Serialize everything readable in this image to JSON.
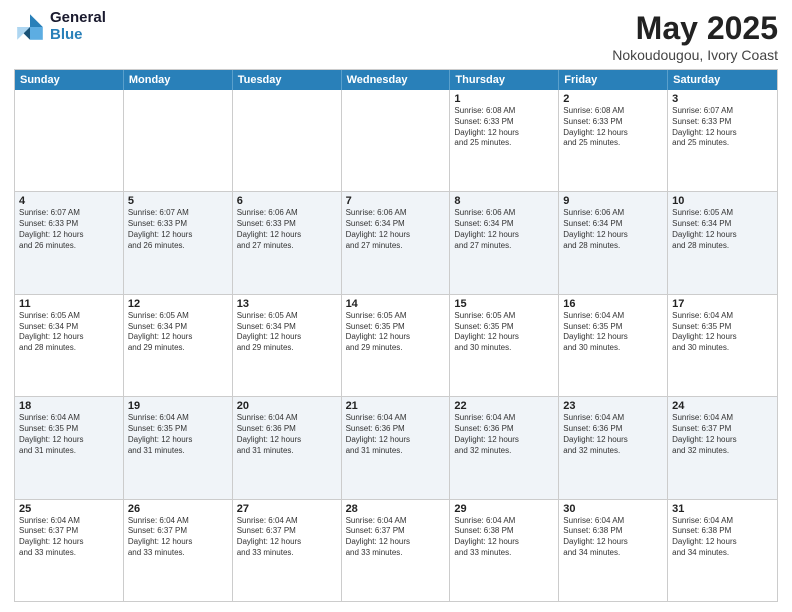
{
  "logo": {
    "line1": "General",
    "line2": "Blue"
  },
  "title": "May 2025",
  "subtitle": "Nokoudougou, Ivory Coast",
  "header_days": [
    "Sunday",
    "Monday",
    "Tuesday",
    "Wednesday",
    "Thursday",
    "Friday",
    "Saturday"
  ],
  "rows": [
    [
      {
        "day": "",
        "info": ""
      },
      {
        "day": "",
        "info": ""
      },
      {
        "day": "",
        "info": ""
      },
      {
        "day": "",
        "info": ""
      },
      {
        "day": "1",
        "info": "Sunrise: 6:08 AM\nSunset: 6:33 PM\nDaylight: 12 hours\nand 25 minutes."
      },
      {
        "day": "2",
        "info": "Sunrise: 6:08 AM\nSunset: 6:33 PM\nDaylight: 12 hours\nand 25 minutes."
      },
      {
        "day": "3",
        "info": "Sunrise: 6:07 AM\nSunset: 6:33 PM\nDaylight: 12 hours\nand 25 minutes."
      }
    ],
    [
      {
        "day": "4",
        "info": "Sunrise: 6:07 AM\nSunset: 6:33 PM\nDaylight: 12 hours\nand 26 minutes."
      },
      {
        "day": "5",
        "info": "Sunrise: 6:07 AM\nSunset: 6:33 PM\nDaylight: 12 hours\nand 26 minutes."
      },
      {
        "day": "6",
        "info": "Sunrise: 6:06 AM\nSunset: 6:33 PM\nDaylight: 12 hours\nand 27 minutes."
      },
      {
        "day": "7",
        "info": "Sunrise: 6:06 AM\nSunset: 6:34 PM\nDaylight: 12 hours\nand 27 minutes."
      },
      {
        "day": "8",
        "info": "Sunrise: 6:06 AM\nSunset: 6:34 PM\nDaylight: 12 hours\nand 27 minutes."
      },
      {
        "day": "9",
        "info": "Sunrise: 6:06 AM\nSunset: 6:34 PM\nDaylight: 12 hours\nand 28 minutes."
      },
      {
        "day": "10",
        "info": "Sunrise: 6:05 AM\nSunset: 6:34 PM\nDaylight: 12 hours\nand 28 minutes."
      }
    ],
    [
      {
        "day": "11",
        "info": "Sunrise: 6:05 AM\nSunset: 6:34 PM\nDaylight: 12 hours\nand 28 minutes."
      },
      {
        "day": "12",
        "info": "Sunrise: 6:05 AM\nSunset: 6:34 PM\nDaylight: 12 hours\nand 29 minutes."
      },
      {
        "day": "13",
        "info": "Sunrise: 6:05 AM\nSunset: 6:34 PM\nDaylight: 12 hours\nand 29 minutes."
      },
      {
        "day": "14",
        "info": "Sunrise: 6:05 AM\nSunset: 6:35 PM\nDaylight: 12 hours\nand 29 minutes."
      },
      {
        "day": "15",
        "info": "Sunrise: 6:05 AM\nSunset: 6:35 PM\nDaylight: 12 hours\nand 30 minutes."
      },
      {
        "day": "16",
        "info": "Sunrise: 6:04 AM\nSunset: 6:35 PM\nDaylight: 12 hours\nand 30 minutes."
      },
      {
        "day": "17",
        "info": "Sunrise: 6:04 AM\nSunset: 6:35 PM\nDaylight: 12 hours\nand 30 minutes."
      }
    ],
    [
      {
        "day": "18",
        "info": "Sunrise: 6:04 AM\nSunset: 6:35 PM\nDaylight: 12 hours\nand 31 minutes."
      },
      {
        "day": "19",
        "info": "Sunrise: 6:04 AM\nSunset: 6:35 PM\nDaylight: 12 hours\nand 31 minutes."
      },
      {
        "day": "20",
        "info": "Sunrise: 6:04 AM\nSunset: 6:36 PM\nDaylight: 12 hours\nand 31 minutes."
      },
      {
        "day": "21",
        "info": "Sunrise: 6:04 AM\nSunset: 6:36 PM\nDaylight: 12 hours\nand 31 minutes."
      },
      {
        "day": "22",
        "info": "Sunrise: 6:04 AM\nSunset: 6:36 PM\nDaylight: 12 hours\nand 32 minutes."
      },
      {
        "day": "23",
        "info": "Sunrise: 6:04 AM\nSunset: 6:36 PM\nDaylight: 12 hours\nand 32 minutes."
      },
      {
        "day": "24",
        "info": "Sunrise: 6:04 AM\nSunset: 6:37 PM\nDaylight: 12 hours\nand 32 minutes."
      }
    ],
    [
      {
        "day": "25",
        "info": "Sunrise: 6:04 AM\nSunset: 6:37 PM\nDaylight: 12 hours\nand 33 minutes."
      },
      {
        "day": "26",
        "info": "Sunrise: 6:04 AM\nSunset: 6:37 PM\nDaylight: 12 hours\nand 33 minutes."
      },
      {
        "day": "27",
        "info": "Sunrise: 6:04 AM\nSunset: 6:37 PM\nDaylight: 12 hours\nand 33 minutes."
      },
      {
        "day": "28",
        "info": "Sunrise: 6:04 AM\nSunset: 6:37 PM\nDaylight: 12 hours\nand 33 minutes."
      },
      {
        "day": "29",
        "info": "Sunrise: 6:04 AM\nSunset: 6:38 PM\nDaylight: 12 hours\nand 33 minutes."
      },
      {
        "day": "30",
        "info": "Sunrise: 6:04 AM\nSunset: 6:38 PM\nDaylight: 12 hours\nand 34 minutes."
      },
      {
        "day": "31",
        "info": "Sunrise: 6:04 AM\nSunset: 6:38 PM\nDaylight: 12 hours\nand 34 minutes."
      }
    ]
  ]
}
